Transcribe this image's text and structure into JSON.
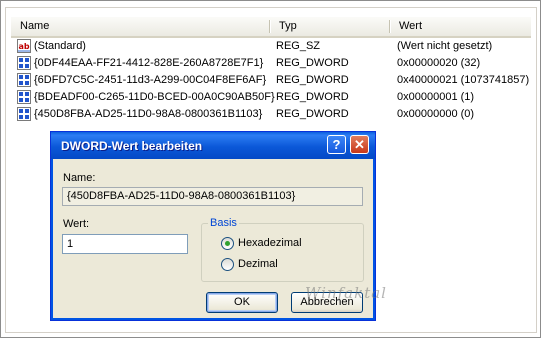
{
  "columns": {
    "name": "Name",
    "type": "Typ",
    "value": "Wert"
  },
  "rows": [
    {
      "icon": "string-value-icon",
      "name": "(Standard)",
      "type": "REG_SZ",
      "value": "(Wert nicht gesetzt)"
    },
    {
      "icon": "binary-value-icon",
      "name": "{0DF44EAA-FF21-4412-828E-260A8728E7F1}",
      "type": "REG_DWORD",
      "value": "0x00000020 (32)"
    },
    {
      "icon": "binary-value-icon",
      "name": "{6DFD7C5C-2451-11d3-A299-00C04F8EF6AF}",
      "type": "REG_DWORD",
      "value": "0x40000021 (1073741857)"
    },
    {
      "icon": "binary-value-icon",
      "name": "{BDEADF00-C265-11D0-BCED-00A0C90AB50F}",
      "type": "REG_DWORD",
      "value": "0x00000001 (1)"
    },
    {
      "icon": "binary-value-icon",
      "name": "{450D8FBA-AD25-11D0-98A8-0800361B1103}",
      "type": "REG_DWORD",
      "value": "0x00000000 (0)"
    }
  ],
  "dialog": {
    "title": "DWORD-Wert bearbeiten",
    "help_glyph": "?",
    "close_glyph": "✕",
    "name_label": "Name:",
    "name_value": "{450D8FBA-AD25-11D0-98A8-0800361B1103}",
    "value_label": "Wert:",
    "value_input": "1",
    "base_group": "Basis",
    "base_options": [
      {
        "label": "Hexadezimal",
        "selected": true
      },
      {
        "label": "Dezimal",
        "selected": false
      }
    ],
    "ok_label": "OK",
    "cancel_label": "Abbrechen"
  },
  "watermark": "Winfaktal",
  "colors": {
    "title_bar": "#0b58d8",
    "dialog_bg": "#ece9d8",
    "group_title": "#0046d5"
  }
}
